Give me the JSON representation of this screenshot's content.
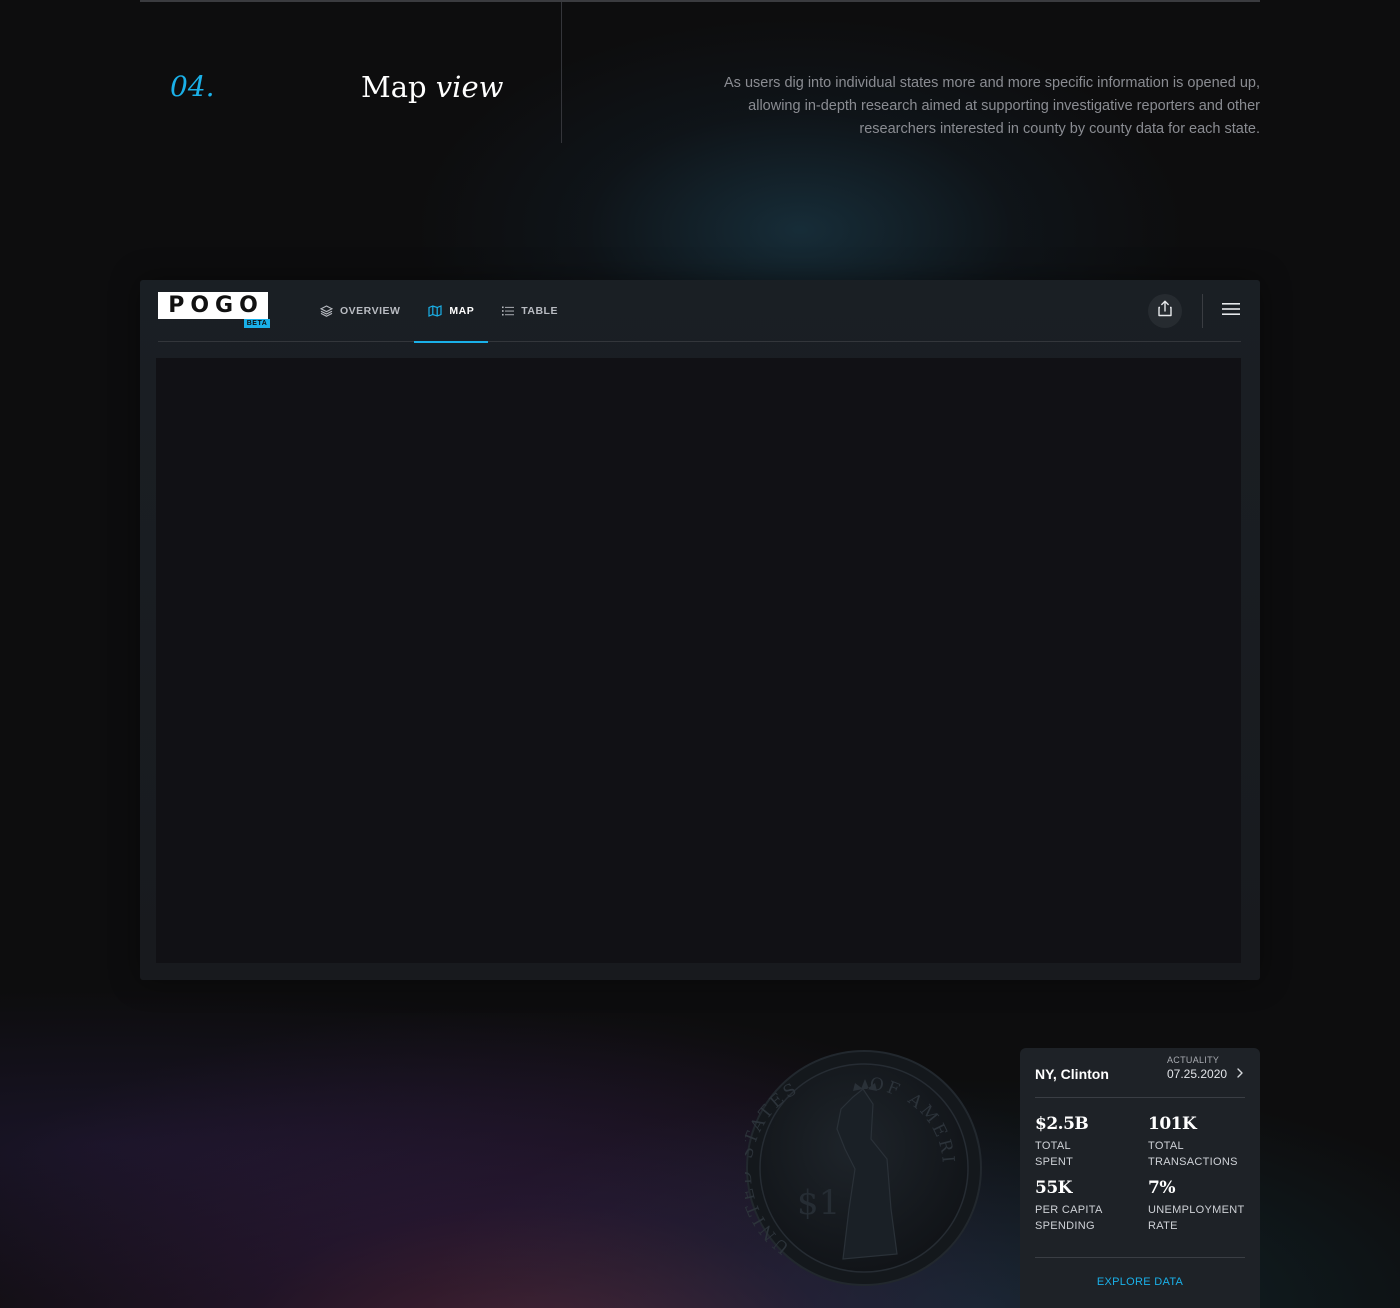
{
  "section": {
    "number": "04.",
    "title_plain": "Map",
    "title_italic": "view",
    "description": "As users dig into individual states more and more specific information is opened up, allowing in-depth research aimed at supporting investigative reporters and other researchers interested in county by county data for each state."
  },
  "app": {
    "logo_text": "POGO",
    "logo_badge": "BETA",
    "tabs": [
      {
        "label": "OVERVIEW",
        "icon": "layers-icon",
        "active": false
      },
      {
        "label": "MAP",
        "icon": "map-icon",
        "active": true
      },
      {
        "label": "TABLE",
        "icon": "list-icon",
        "active": false
      }
    ],
    "share_icon": "share-icon",
    "menu_icon": "hamburger-menu-icon"
  },
  "card": {
    "location": "NY, Clinton",
    "actuality_label": "ACTUALITY",
    "actuality_date": "07.25.2020",
    "stats": [
      {
        "value": "$2.5B",
        "label": "TOTAL\nSPENT"
      },
      {
        "value": "101K",
        "label": "TOTAL\nTRANSACTIONS"
      },
      {
        "value": "55K",
        "label": "PER CAPITA\nSPENDING"
      },
      {
        "value": "7%",
        "label": "UNEMPLOYMENT\nRATE"
      }
    ],
    "explore_label": "EXPLORE DATA"
  },
  "coin": {
    "top_text": "OF AMERICA",
    "side_text": "UNITED STATES",
    "value_text": "$1"
  },
  "colors": {
    "accent": "#1ab0e8",
    "background": "#0d0d0e",
    "panel": "#1e2227",
    "map": "#111115"
  }
}
